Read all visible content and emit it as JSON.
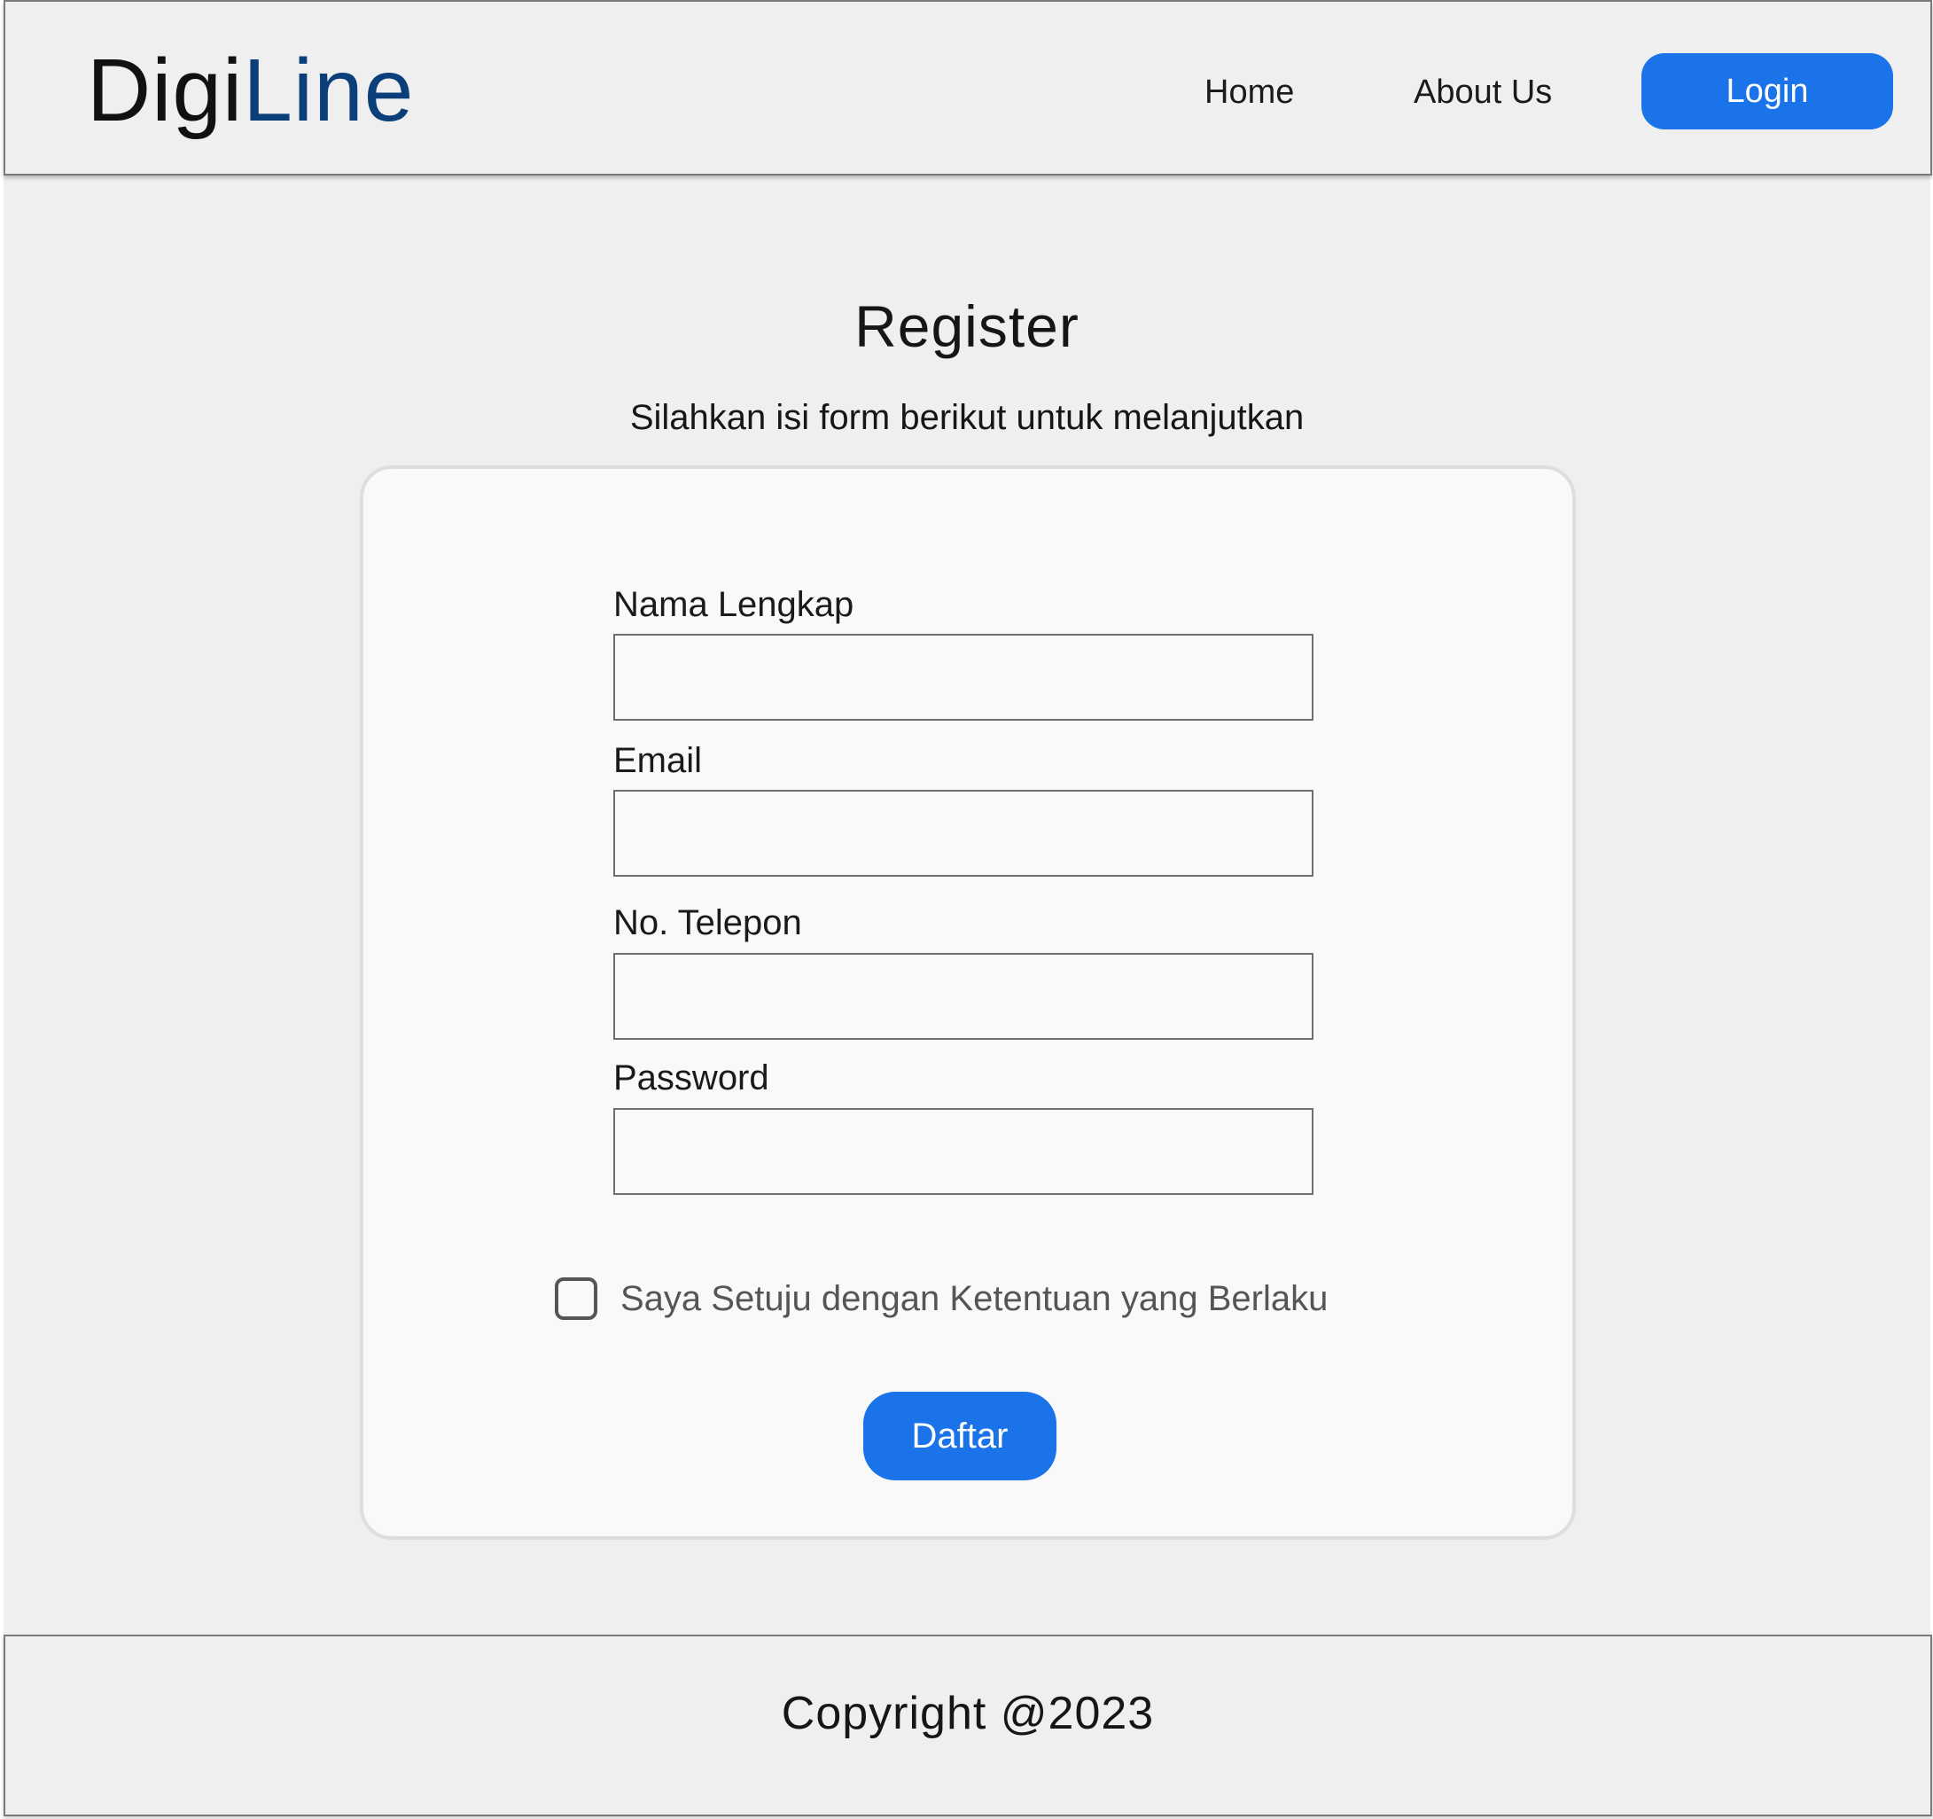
{
  "colors": {
    "accent": "#1a73e8",
    "logo_accent": "#0b3f7a",
    "background": "#efefef",
    "card": "#f9f9f9"
  },
  "header": {
    "logo_part1": "Digi",
    "logo_part2": "Line",
    "nav": {
      "home": "Home",
      "about": "About Us"
    },
    "login_label": "Login"
  },
  "main": {
    "title": "Register",
    "subtitle": "Silahkan isi form berikut untuk melanjutkan"
  },
  "form": {
    "fields": [
      {
        "label": "Nama Lengkap",
        "value": ""
      },
      {
        "label": "Email",
        "value": ""
      },
      {
        "label": "No. Telepon",
        "value": ""
      },
      {
        "label": "Password",
        "value": ""
      }
    ],
    "agreement": {
      "label": "Saya Setuju dengan Ketentuan yang Berlaku",
      "checked": false
    },
    "submit_label": "Daftar"
  },
  "footer": {
    "copyright": "Copyright @2023"
  }
}
